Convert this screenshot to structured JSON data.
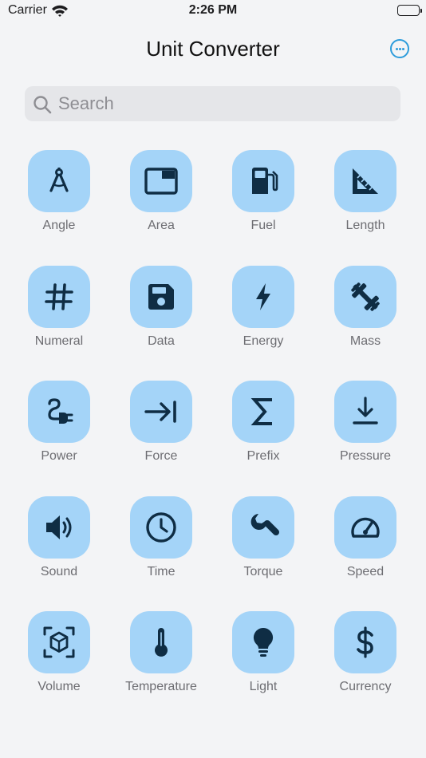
{
  "status_bar": {
    "carrier": "Carrier",
    "time": "2:26 PM"
  },
  "header": {
    "title": "Unit Converter",
    "more_icon": "ellipsis-circle-icon"
  },
  "search": {
    "placeholder": "Search",
    "value": ""
  },
  "colors": {
    "accent": "#2d9cdb",
    "tile_background": "#a4d4f8",
    "icon": "#0f2d44",
    "background": "#f3f4f6"
  },
  "categories": [
    {
      "label": "Angle",
      "icon": "compass-icon"
    },
    {
      "label": "Area",
      "icon": "area-icon"
    },
    {
      "label": "Fuel",
      "icon": "gas-pump-icon"
    },
    {
      "label": "Length",
      "icon": "ruler-triangle-icon"
    },
    {
      "label": "Numeral",
      "icon": "hashtag-icon"
    },
    {
      "label": "Data",
      "icon": "floppy-disk-icon"
    },
    {
      "label": "Energy",
      "icon": "bolt-icon"
    },
    {
      "label": "Mass",
      "icon": "dumbbell-icon"
    },
    {
      "label": "Power",
      "icon": "plug-icon"
    },
    {
      "label": "Force",
      "icon": "arrow-to-line-icon"
    },
    {
      "label": "Prefix",
      "icon": "sigma-icon"
    },
    {
      "label": "Pressure",
      "icon": "download-arrow-icon"
    },
    {
      "label": "Sound",
      "icon": "speaker-icon"
    },
    {
      "label": "Time",
      "icon": "clock-icon"
    },
    {
      "label": "Torque",
      "icon": "wrench-icon"
    },
    {
      "label": "Speed",
      "icon": "speedometer-icon"
    },
    {
      "label": "Volume",
      "icon": "cube-scan-icon"
    },
    {
      "label": "Temperature",
      "icon": "thermometer-icon"
    },
    {
      "label": "Light",
      "icon": "lightbulb-icon"
    },
    {
      "label": "Currency",
      "icon": "dollar-icon"
    }
  ]
}
